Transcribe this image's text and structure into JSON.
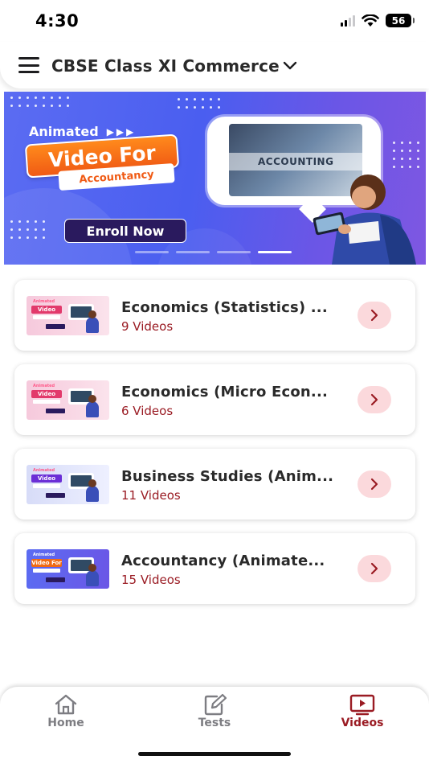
{
  "status_bar": {
    "time": "4:30",
    "battery": "56"
  },
  "header": {
    "title": "CBSE Class XI Commerce",
    "menu_icon": "hamburger-icon",
    "dropdown_icon": "chevron-down-icon"
  },
  "banner": {
    "tag": "Animated",
    "headline": "Video For",
    "subject": "Accountancy",
    "cta": "Enroll Now",
    "screen_text": "ACCOUNTING",
    "slides": 4,
    "active_slide": 4
  },
  "courses": [
    {
      "title": "Economics (Statistics) ...",
      "count": "9 Videos",
      "thumb_text": "Video"
    },
    {
      "title": "Economics (Micro Econ...",
      "count": "6 Videos",
      "thumb_text": "Video"
    },
    {
      "title": "Business Studies (Anim...",
      "count": "11 Videos",
      "thumb_text": "Video"
    },
    {
      "title": "Accountancy (Animate...",
      "count": "15 Videos",
      "thumb_text": "Video For"
    }
  ],
  "bottom_nav": [
    {
      "label": "Home",
      "icon": "home-icon",
      "active": false
    },
    {
      "label": "Tests",
      "icon": "edit-icon",
      "active": false
    },
    {
      "label": "Videos",
      "icon": "video-icon",
      "active": true
    }
  ],
  "colors": {
    "accent": "#9a1b23",
    "arrow_bg": "#fbd9dc",
    "banner_bg": "#4a5ef0"
  }
}
